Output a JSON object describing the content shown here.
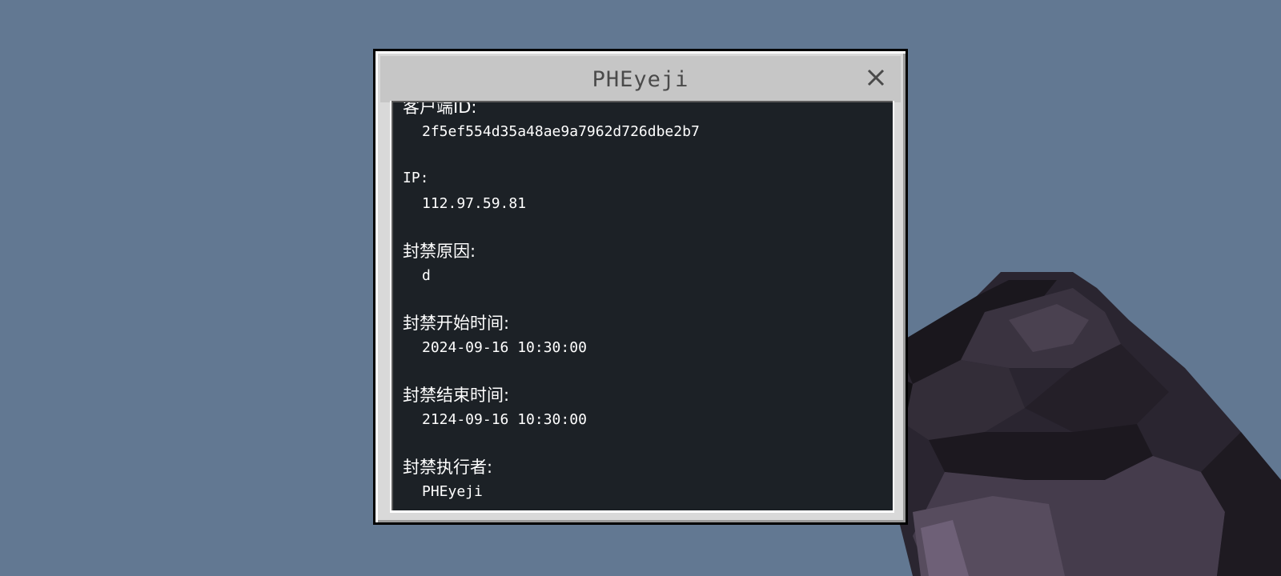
{
  "dialog": {
    "title": "PHEyeji",
    "close_icon": "close-icon"
  },
  "fields": [
    {
      "label": "客户端ID:",
      "value": "2f5ef554d35a48ae9a7962d726dbe2b7"
    },
    {
      "label": "IP:",
      "value": "112.97.59.81"
    },
    {
      "label": "封禁原因:",
      "value": "d"
    },
    {
      "label": "封禁开始时间:",
      "value": "2024-09-16 10:30:00"
    },
    {
      "label": "封禁结束时间:",
      "value": "2124-09-16 10:30:00"
    },
    {
      "label": "封禁执行者:",
      "value": "PHEyeji"
    }
  ],
  "colors": {
    "sky": "#627892",
    "panel": "#1c2126",
    "frame": "#c6c6c6",
    "title_text": "#4a4a4a"
  }
}
